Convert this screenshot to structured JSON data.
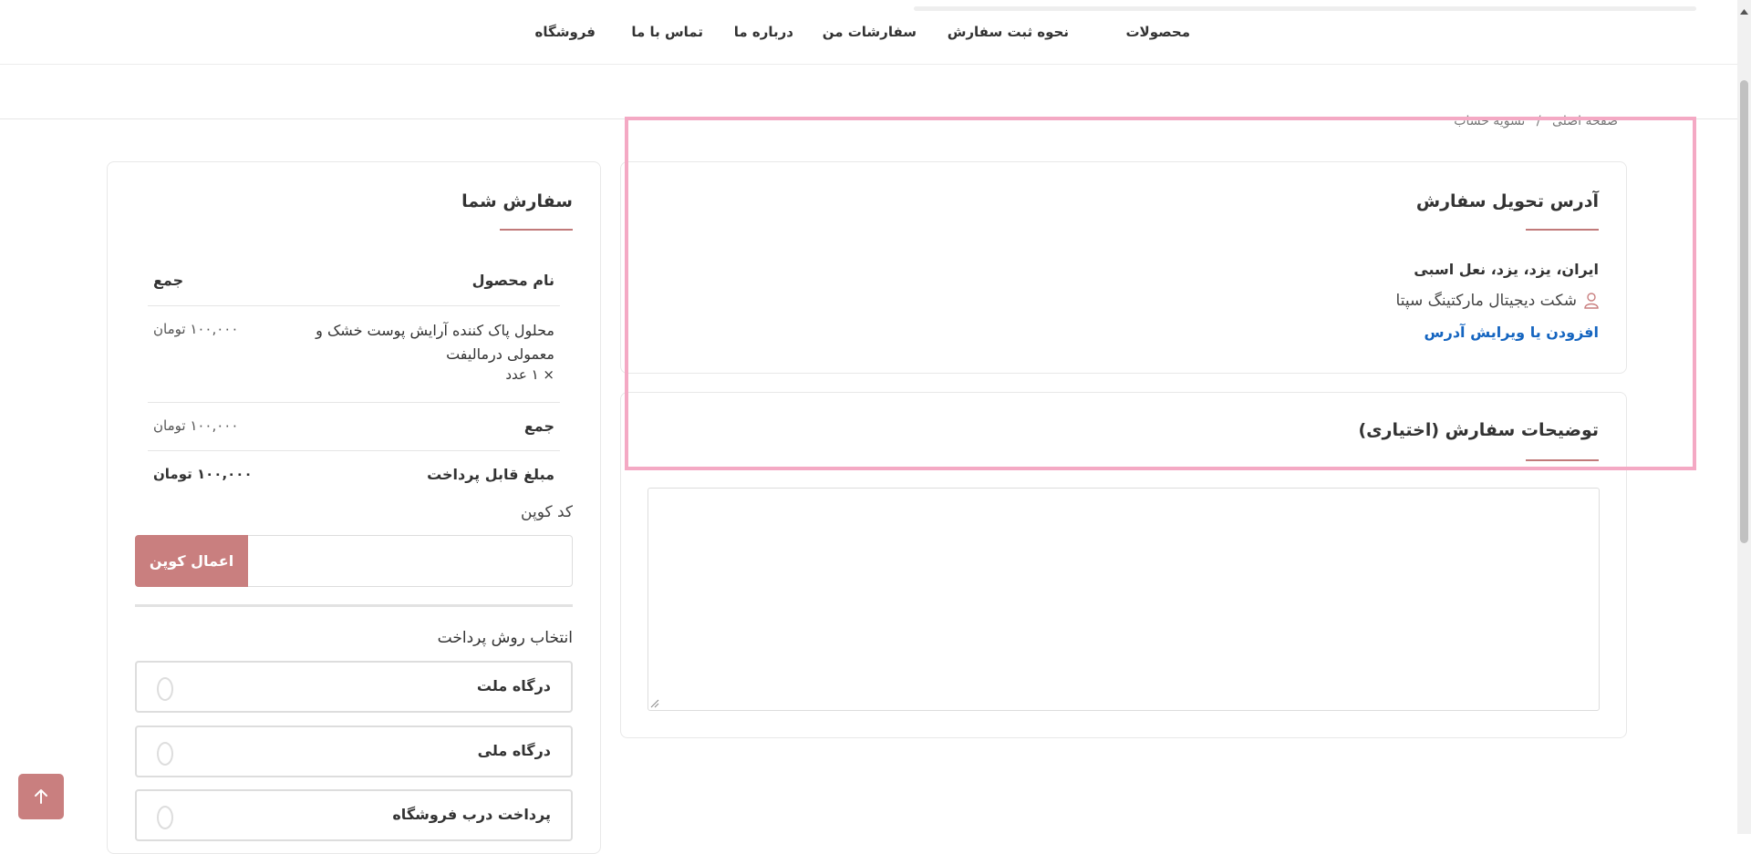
{
  "nav": {
    "items": [
      "محصولات",
      "نحوه ثبت سفارش",
      "سفارشات من",
      "درباره ما",
      "تماس با ما",
      "فروشگاه"
    ]
  },
  "breadcrumb": {
    "home": "صفحه اصلی",
    "separator": "/",
    "current": "تسویه حساب"
  },
  "address": {
    "title": "آدرس تحویل سفارش",
    "line": "ایران، یزد، یزد، نعل اسبی",
    "recipient": "شکت دیجیتال مارکتینگ سپتا",
    "edit_link": "افزودن یا ویرایش آدرس"
  },
  "notes": {
    "title": "توضیحات سفارش (اختیاری)"
  },
  "order": {
    "title": "سفارش شما",
    "col_product": "نام محصول",
    "col_total": "جمع",
    "items": [
      {
        "name": "محلول پاک کننده آرایش پوست خشک و معمولی درمالیفت",
        "qty": "× ۱ عدد",
        "total": "۱۰۰,۰۰۰ تومان"
      }
    ],
    "subtotal_label": "جمع",
    "subtotal_value": "۱۰۰,۰۰۰ تومان",
    "payable_label": "مبلغ قابل پرداخت",
    "payable_value": "۱۰۰,۰۰۰  تومان"
  },
  "coupon": {
    "label": "کد کوپن",
    "value": "",
    "button": "اعمال کوپن"
  },
  "payment": {
    "title": "انتخاب روش پرداخت",
    "options": [
      "درگاه ملت",
      "درگاه ملی",
      "پرداخت درب فروشگاه"
    ]
  },
  "colors": {
    "accent": "#c97f7f",
    "link": "#1565c0",
    "highlight": "#f4a9c4"
  }
}
